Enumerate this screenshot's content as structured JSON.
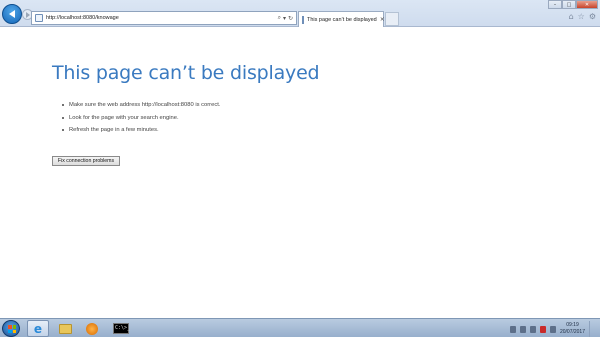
{
  "browser": {
    "address": {
      "url": "http://localhost:8080/knowage",
      "search_symbol": "⌕",
      "dropdown_symbol": "▾",
      "refresh_symbol": "↻"
    },
    "tab": {
      "title": "This page can’t be displayed",
      "close_symbol": "×"
    },
    "window_controls": {
      "minimize": "–",
      "maximize": "□",
      "close": "✕"
    },
    "toolbar_icons": {
      "home": "⌂",
      "favorites": "☆",
      "settings": "⚙"
    }
  },
  "page": {
    "heading": "This page can’t be displayed",
    "bullets": [
      "Make sure the web address http://localhost:8080 is correct.",
      "Look for the page with your search engine.",
      "Refresh the page in a few minutes."
    ],
    "fix_button_label": "Fix connection problems"
  },
  "taskbar": {
    "ie_symbol": "e",
    "cmd_prompt_text": "C:\\>_",
    "clock": {
      "time": "09:19",
      "date": "20/07/2017"
    }
  },
  "colors": {
    "heading_blue": "#3a7ac0",
    "chrome_bg": "#cfdcee",
    "taskbar_bg": "#a8bdd6"
  }
}
